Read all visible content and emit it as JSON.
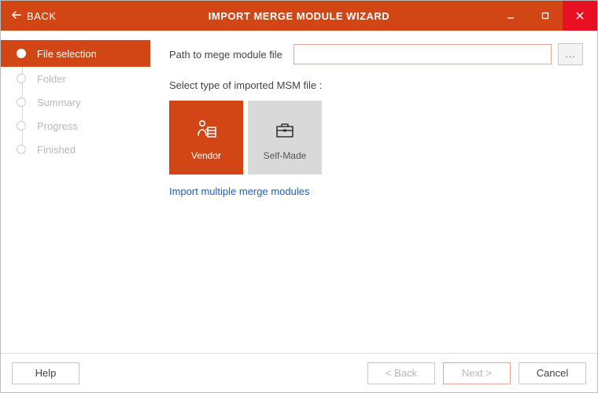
{
  "titlebar": {
    "back_label": "BACK",
    "title": "IMPORT MERGE MODULE WIZARD"
  },
  "sidebar": {
    "steps": [
      {
        "label": "File selection",
        "active": true
      },
      {
        "label": "Folder",
        "active": false
      },
      {
        "label": "Summary",
        "active": false
      },
      {
        "label": "Progress",
        "active": false
      },
      {
        "label": "Finished",
        "active": false
      }
    ]
  },
  "main": {
    "path_label": "Path to mege module file",
    "path_value": "",
    "browse_label": "...",
    "select_type_label": "Select type of imported MSM file :",
    "tiles": {
      "vendor": "Vendor",
      "selfmade": "Self-Made"
    },
    "link_label": "Import multiple merge modules"
  },
  "footer": {
    "help": "Help",
    "back": "< Back",
    "next": "Next >",
    "cancel": "Cancel"
  },
  "colors": {
    "accent": "#d24615",
    "close": "#e81123"
  }
}
